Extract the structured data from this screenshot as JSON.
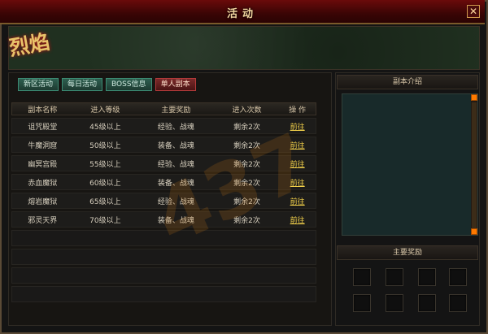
{
  "window": {
    "title": "活动",
    "close_glyph": "✕"
  },
  "logo_text": "烈焰",
  "tabs": [
    {
      "label": "新区活动",
      "active": false
    },
    {
      "label": "每日活动",
      "active": false
    },
    {
      "label": "BOSS信息",
      "active": false
    },
    {
      "label": "单人副本",
      "active": true
    }
  ],
  "table": {
    "headers": [
      "副本名称",
      "进入等级",
      "主要奖励",
      "进入次数",
      "操 作"
    ],
    "rows": [
      {
        "name": "诅咒殿堂",
        "level": "45级以上",
        "reward": "经验、战魂",
        "count": "剩余2次",
        "action": "前往"
      },
      {
        "name": "牛魔洞窟",
        "level": "50级以上",
        "reward": "装备、战魂",
        "count": "剩余2次",
        "action": "前往"
      },
      {
        "name": "幽冥宫殿",
        "level": "55级以上",
        "reward": "经验、战魂",
        "count": "剩余2次",
        "action": "前往"
      },
      {
        "name": "赤血魔狱",
        "level": "60级以上",
        "reward": "装备、战魂",
        "count": "剩余2次",
        "action": "前往"
      },
      {
        "name": "熔岩魔狱",
        "level": "65级以上",
        "reward": "经验、战魂",
        "count": "剩余2次",
        "action": "前往"
      },
      {
        "name": "邪灵天界",
        "level": "70级以上",
        "reward": "装备、战魂",
        "count": "剩余2次",
        "action": "前往"
      }
    ]
  },
  "right": {
    "intro_title": "副本介绍",
    "reward_title": "主要奖励"
  },
  "watermark_text": "437",
  "colors": {
    "title_bar": "#5a0808",
    "tab": "#2e5f4f",
    "tab_active": "#7a2a2a",
    "action_link": "#f2d04a",
    "scroll": "#ff7a00"
  }
}
